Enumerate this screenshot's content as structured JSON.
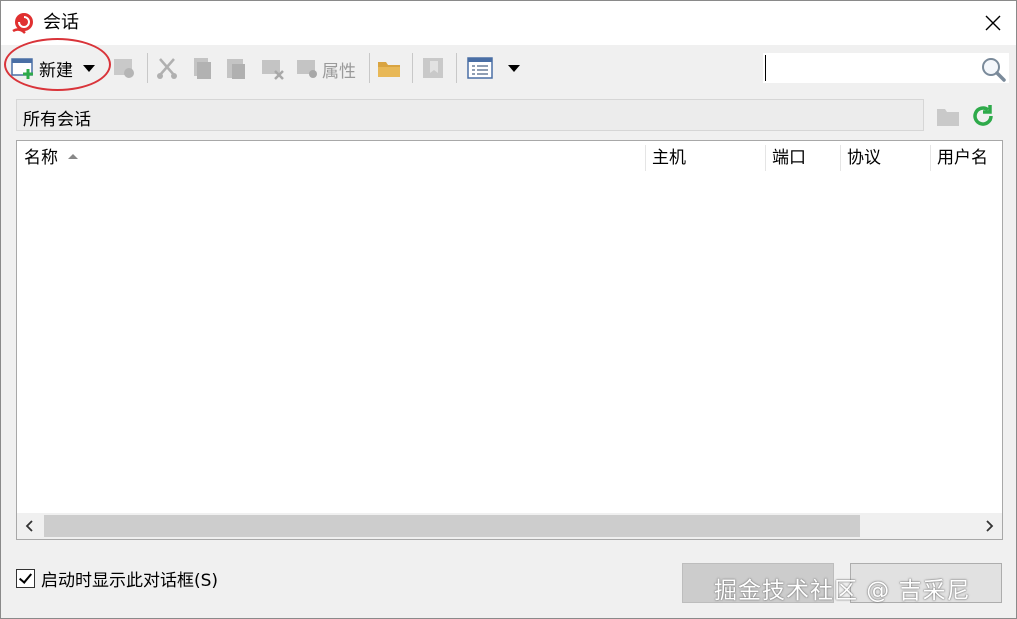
{
  "window": {
    "title": "会话"
  },
  "toolbar": {
    "new_label": "新建",
    "properties_label": "属性",
    "search": {
      "value": "",
      "placeholder": ""
    }
  },
  "pathbar": {
    "text": "所有会话"
  },
  "list": {
    "columns": [
      "名称",
      "主机",
      "端口",
      "协议",
      "用户名"
    ],
    "rows": []
  },
  "footer": {
    "show_on_startup_label": "启动时显示此对话框(S)",
    "show_on_startup_checked": true,
    "connect_label": "",
    "close_label": ""
  },
  "watermark": "掘金技术社区 @ 吉采尼",
  "colors": {
    "highlight": "#d9343a",
    "refresh": "#2eaa4a",
    "folder": "#d9a441"
  }
}
